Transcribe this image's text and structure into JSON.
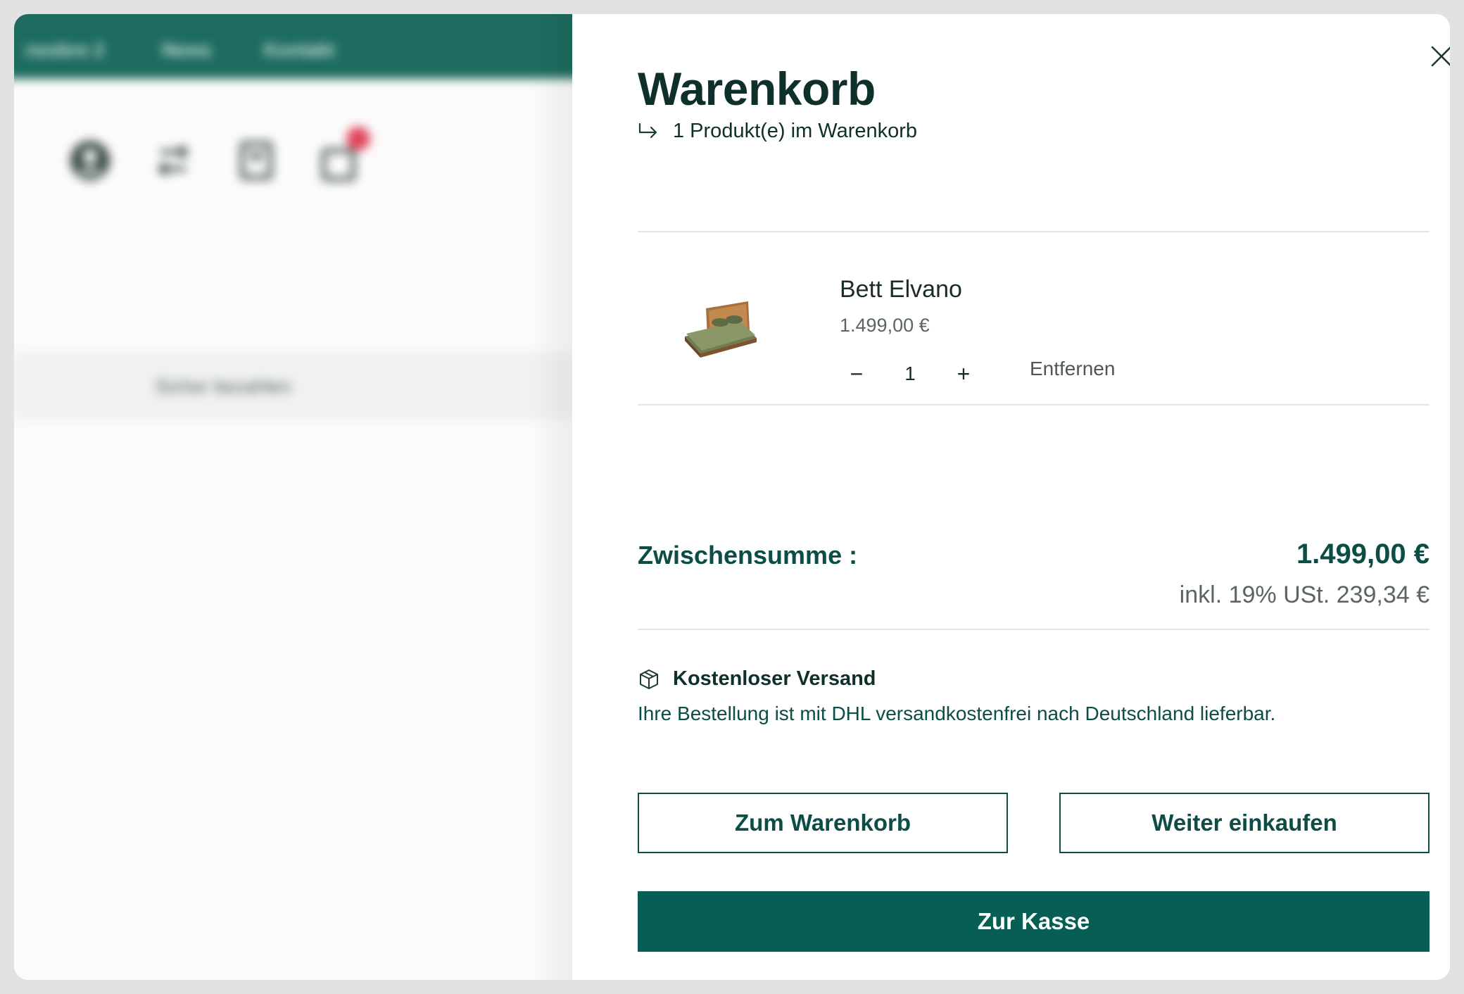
{
  "background": {
    "nav_items": [
      "nosbre 2",
      "News",
      "Kontakt"
    ],
    "strip_text": "Sicher bezahlen",
    "icons": [
      "user-icon",
      "compare-icon",
      "bookmark-icon",
      "bag-icon"
    ],
    "accent": "#1d6b5f",
    "badge_color": "#e0445a"
  },
  "cart": {
    "title": "Warenkorb",
    "subtitle": "1 Produkt(e) im Warenkorb",
    "item": {
      "name": "Bett Elvano",
      "price": "1.499,00 €",
      "quantity": "1",
      "decrement": "−",
      "increment": "+",
      "remove_label": "Entfernen"
    },
    "subtotal_label": "Zwischensumme :",
    "subtotal_value": "1.499,00 €",
    "vat_text": "inkl. 19% USt. 239,34 €",
    "shipping_title": "Kostenloser Versand",
    "shipping_text": "Ihre Bestellung ist mit DHL versandkostenfrei nach Deutschland lieferbar.",
    "buttons": {
      "view_cart": "Zum Warenkorb",
      "continue": "Weiter einkaufen",
      "checkout": "Zur Kasse"
    },
    "colors": {
      "primary": "#065e55",
      "text_dark": "#0f2f2a",
      "text_green": "#0c4d46"
    }
  }
}
